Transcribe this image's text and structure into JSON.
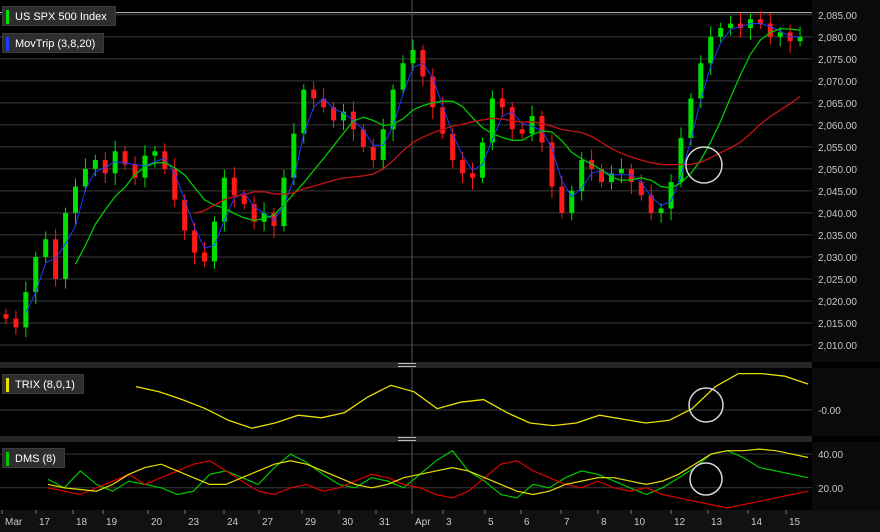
{
  "colors": {
    "up_candle": "#00e000",
    "down_candle": "#ff1a1a",
    "ma_fast": "#1f3cff",
    "ma_mid": "#00c800",
    "ma_slow": "#c81414",
    "trix": "#e8e000",
    "dms_plus": "#00c800",
    "dms_minus": "#e00000",
    "dms_adx": "#e8e000",
    "grid": "#3a3a3a",
    "axis_text": "#c8c8c8",
    "circle": "#d8d8d8"
  },
  "legends": {
    "main_title": "US SPX 500 Index",
    "ma_title": "MovTrip (3,8,20)",
    "trix_title": "TRIX (8,0,1)",
    "dms_title": "DMS (8)"
  },
  "x_axis": {
    "labels": [
      "Mar",
      "17",
      "18",
      "19",
      "20",
      "23",
      "24",
      "27",
      "29",
      "30",
      "31",
      "Apr",
      "3",
      "5",
      "6",
      "7",
      "8",
      "10",
      "12",
      "13",
      "14",
      "15"
    ]
  },
  "chart_data": [
    {
      "type": "candlestick",
      "title": "US SPX 500 Index",
      "overlay": "MovTrip (3,8,20)",
      "y_ticks": [
        "2,010.00",
        "2,015.00",
        "2,020.00",
        "2,025.00",
        "2,030.00",
        "2,035.00",
        "2,040.00",
        "2,045.00",
        "2,050.00",
        "2,055.00",
        "2,060.00",
        "2,065.00",
        "2,070.00",
        "2,075.00",
        "2,080.00",
        "2,085.00"
      ],
      "ylim": [
        2007.5,
        2087
      ],
      "current_price": 2085.5,
      "x_session_labels": [
        "Mar",
        "17",
        "18",
        "19",
        "20",
        "23",
        "24",
        "27",
        "29",
        "30",
        "31",
        "Apr",
        "3",
        "5",
        "6",
        "7",
        "8",
        "10",
        "12",
        "13",
        "14",
        "15"
      ],
      "close_path": [
        2016,
        2014,
        2022,
        2030,
        2034,
        2025,
        2040,
        2046,
        2050,
        2052,
        2049,
        2054,
        2051,
        2048,
        2053,
        2054,
        2050,
        2043,
        2036,
        2031,
        2029,
        2038,
        2048,
        2044,
        2042,
        2038,
        2040,
        2037,
        2048,
        2058,
        2068,
        2066,
        2064,
        2061,
        2063,
        2059,
        2055,
        2052,
        2059,
        2068,
        2074,
        2077,
        2071,
        2064,
        2058,
        2052,
        2049,
        2048,
        2056,
        2066,
        2064,
        2059,
        2058,
        2062,
        2056,
        2046,
        2040,
        2045,
        2052,
        2050,
        2047,
        2049,
        2050,
        2047,
        2044,
        2040,
        2041,
        2047,
        2057,
        2066,
        2074,
        2080,
        2082,
        2083,
        2082,
        2084,
        2083,
        2080,
        2081,
        2079,
        2080
      ],
      "series": [
        {
          "name": "MovTrip 3",
          "role": "ma_fast"
        },
        {
          "name": "MovTrip 8",
          "role": "ma_mid"
        },
        {
          "name": "MovTrip 20",
          "role": "ma_slow"
        }
      ],
      "annotation": "circle marking moving-average crossover near session 12-13"
    },
    {
      "type": "line",
      "title": "TRIX (8,0,1)",
      "y_ticks": [
        "-0.00"
      ],
      "series": [
        {
          "name": "TRIX",
          "values": [
            0.9,
            0.7,
            0.4,
            0.05,
            -0.4,
            -0.7,
            -0.5,
            -0.2,
            -0.3,
            -0.1,
            0.5,
            0.95,
            0.7,
            0.05,
            0.3,
            0.4,
            -0.1,
            -0.5,
            -0.6,
            -0.5,
            -0.2,
            -0.35,
            -0.5,
            -0.4,
            0.05,
            0.9,
            1.4,
            1.4,
            1.3,
            1.0
          ]
        }
      ]
    },
    {
      "type": "line",
      "title": "DMS (8)",
      "y_ticks": [
        "20.00",
        "40.00"
      ],
      "ylim": [
        8,
        46
      ],
      "series": [
        {
          "name": "+DI",
          "values": [
            25,
            20,
            30,
            22,
            18,
            24,
            22,
            20,
            16,
            18,
            28,
            30,
            26,
            22,
            32,
            40,
            35,
            28,
            22,
            20,
            26,
            24,
            20,
            28,
            36,
            42,
            30,
            24,
            16,
            14,
            22,
            20,
            26,
            30,
            28,
            24,
            20,
            16,
            20,
            26,
            32,
            40,
            42,
            38,
            32,
            30,
            28,
            26
          ]
        },
        {
          "name": "-DI",
          "values": [
            20,
            18,
            16,
            20,
            24,
            28,
            22,
            26,
            30,
            34,
            36,
            30,
            24,
            18,
            16,
            20,
            22,
            18,
            20,
            24,
            28,
            26,
            22,
            20,
            16,
            14,
            18,
            26,
            34,
            36,
            30,
            26,
            22,
            20,
            24,
            20,
            18,
            20,
            16,
            14,
            12,
            10,
            8,
            10,
            12,
            14,
            16,
            18
          ]
        },
        {
          "name": "ADX",
          "values": [
            22,
            20,
            19,
            18,
            22,
            28,
            32,
            34,
            30,
            26,
            22,
            22,
            26,
            30,
            34,
            36,
            34,
            30,
            26,
            22,
            20,
            22,
            26,
            28,
            30,
            32,
            30,
            26,
            22,
            18,
            16,
            18,
            22,
            24,
            26,
            26,
            24,
            22,
            24,
            28,
            34,
            40,
            42,
            42,
            43,
            42,
            40,
            38
          ]
        }
      ]
    }
  ]
}
